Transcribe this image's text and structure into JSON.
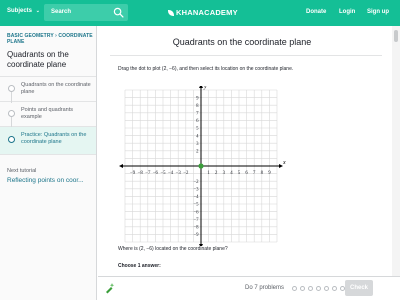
{
  "topbar": {
    "subjects_label": "Subjects",
    "subjects_chevron_icon": "chevron-down-icon",
    "search_placeholder": "Search",
    "search_icon": "search-icon",
    "logo_text": "KHANACADEMY",
    "links": [
      "Donate",
      "Login",
      "Sign up"
    ],
    "color": "#14bf96"
  },
  "sidebar": {
    "breadcrumb": "BASIC GEOMETRY › COORDINATE PLANE",
    "title": "Quadrants on the coordinate plane",
    "items": [
      {
        "label": "Quadrants on the coordinate plane",
        "icon": "video-dot-icon",
        "active": false
      },
      {
        "label": "Points and quadrants example",
        "icon": "video-dot-icon",
        "active": false
      },
      {
        "label": "Practice: Quadrants on the coordinate plane",
        "icon": "exercise-dot-icon",
        "active": true
      }
    ],
    "next_label": "Next tutorial",
    "next_link": "Reflecting points on coor..."
  },
  "main": {
    "title": "Quadrants on the coordinate plane",
    "prompt": "Drag the dot to plot (2, −6), and then select its location on the coordinate plane.",
    "question": "Where is (2, −6) located on the coordinate plane?",
    "choose": "Choose 1 answer:"
  },
  "graph": {
    "x_label": "x",
    "y_label": "y",
    "x_min": -10,
    "x_max": 10,
    "y_min": -10,
    "y_max": 10,
    "x_ticks": [
      -9,
      -8,
      -7,
      -6,
      -5,
      -4,
      -3,
      -2,
      2,
      3,
      4,
      5,
      6,
      7,
      8,
      9
    ],
    "y_ticks": [
      9,
      8,
      7,
      6,
      5,
      4,
      3,
      2,
      -2,
      -3,
      -4,
      -5,
      -6,
      -7,
      -8,
      -9
    ],
    "one_label": "1",
    "dot_color": "#3a9e3a"
  },
  "bottombar": {
    "icon": "sparkle-pencil-icon",
    "problems_text": "Do 7 problems",
    "progress_total": 7,
    "progress_done": 0,
    "check_label": "Check"
  }
}
